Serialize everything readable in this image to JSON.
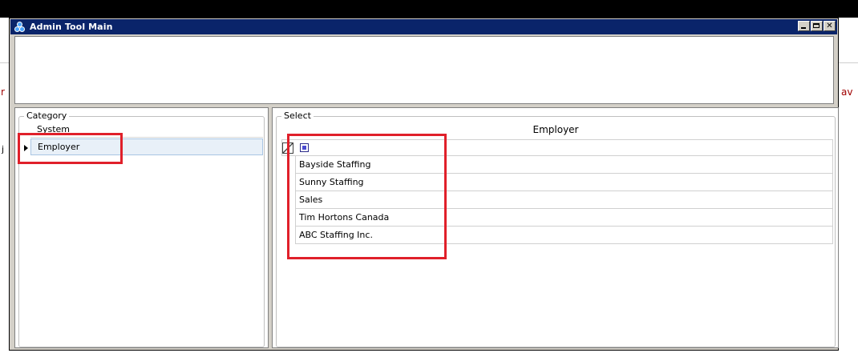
{
  "window": {
    "title": "Admin Tool Main"
  },
  "category": {
    "legend": "Category",
    "items": [
      {
        "label": "System",
        "selected": false
      },
      {
        "label": "Employer",
        "selected": true
      }
    ]
  },
  "select": {
    "legend": "Select",
    "grid_title": "Employer",
    "rows": [
      "Bayside Staffing",
      "Sunny Staffing",
      "Sales",
      "Tim Hortons Canada",
      "ABC Staffing Inc."
    ]
  },
  "background_fragments": {
    "left_char": "r",
    "right_chars": "av",
    "left_char2": "j"
  },
  "colors": {
    "titlebar": "#0a246a",
    "highlight": "#e0202a",
    "selected_row": "#e8f0f8"
  },
  "icons": {
    "window_icon": "app-logo-icon",
    "row_indicator": "triangle-right-icon",
    "grid_header": "grid-settings-icon",
    "select_all": "checkbox-icon"
  }
}
